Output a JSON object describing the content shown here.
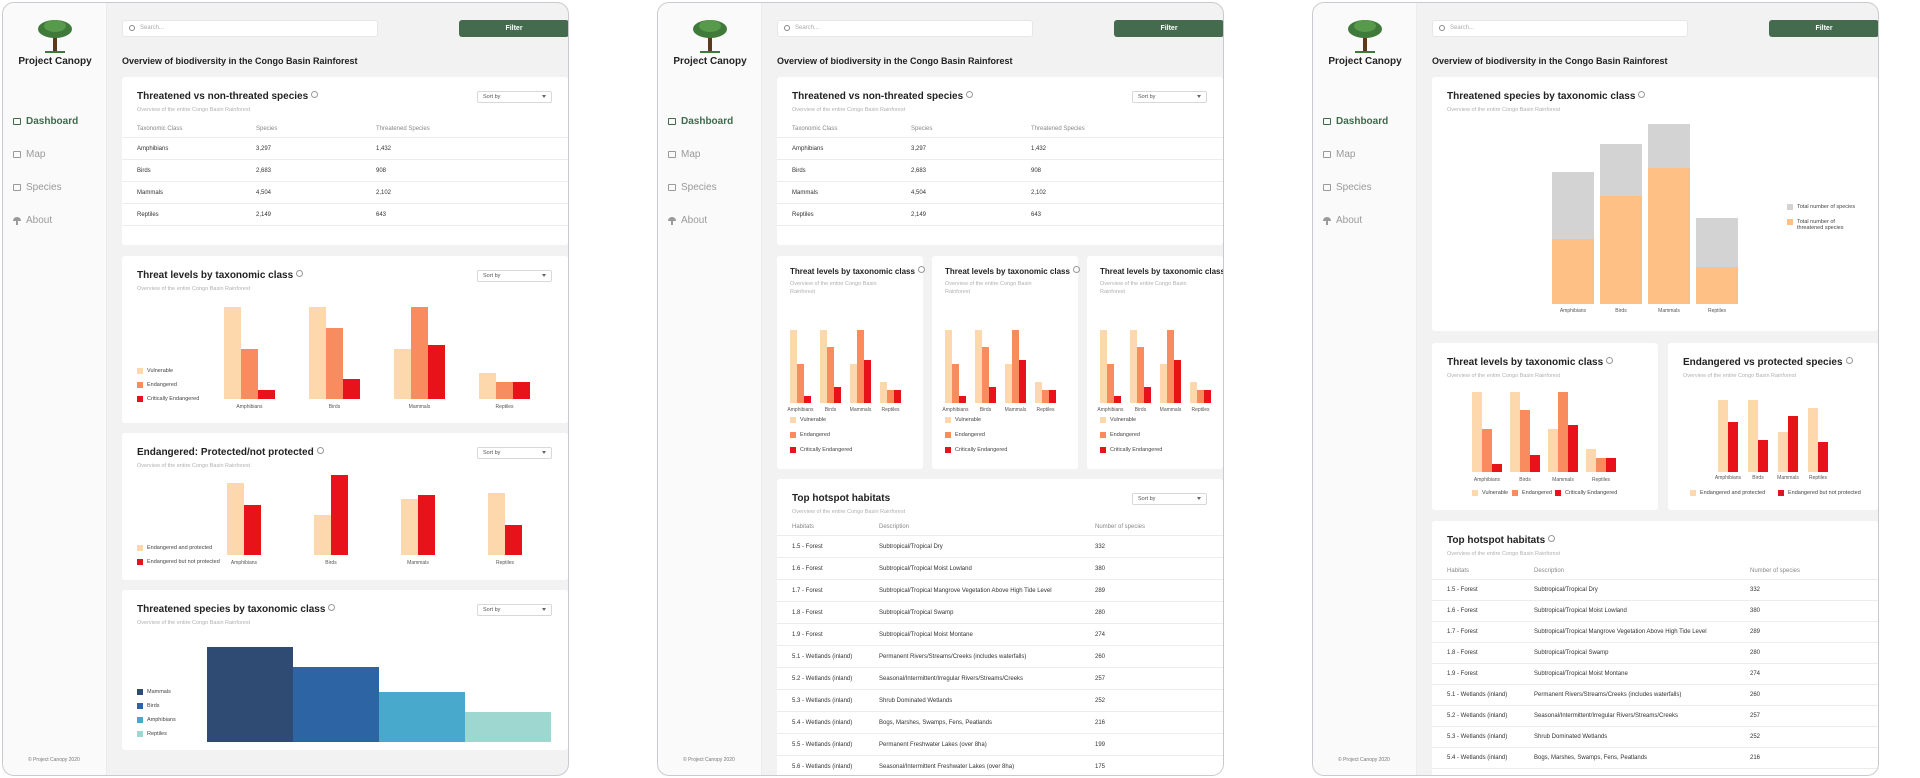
{
  "app": {
    "brand": "Project Canopy",
    "footer": "© Project Canopy 2020",
    "search_placeholder": "Search...",
    "filter_label": "Filter",
    "page_title": "Overview of biodiversity in the Congo Basin Rainforest"
  },
  "nav": [
    {
      "label": "Dashboard",
      "icon": "dashboard-icon"
    },
    {
      "label": "Map",
      "icon": "map-icon"
    },
    {
      "label": "Species",
      "icon": "species-icon"
    },
    {
      "label": "About",
      "icon": "tree-icon"
    }
  ],
  "common": {
    "sort_label": "Sort by",
    "subtitle": "Overview of the entire Congo Basin Rainforest"
  },
  "titles": {
    "threatened_vs": "Threatened vs non-threated species",
    "threat_levels": "Threat levels by taxonomic class",
    "endangered_pn": "Endangered: Protected/not protected",
    "threatened_by_class": "Threatened species by taxonomic class",
    "hotspots": "Top hotspot habitats",
    "endangered_vs_protected": "Endangered vs protected species"
  },
  "species_table": {
    "headers": [
      "Taxonomic Class",
      "Species",
      "Threatened Species"
    ],
    "rows": [
      [
        "Amphibians",
        "3,297",
        "1,432"
      ],
      [
        "Birds",
        "2,683",
        "908"
      ],
      [
        "Mammals",
        "4,504",
        "2,102"
      ],
      [
        "Reptiles",
        "2,149",
        "643"
      ]
    ]
  },
  "habitat_table": {
    "headers": [
      "Habitats",
      "Description",
      "Number of species"
    ],
    "rows": [
      [
        "1.5 - Forest",
        "Subtropical/Tropical Dry",
        "332"
      ],
      [
        "1.6 - Forest",
        "Subtropical/Tropical Moist Lowland",
        "380"
      ],
      [
        "1.7 - Forest",
        "Subtropical/Tropical Mangrove Vegetation Above High Tide Level",
        "289"
      ],
      [
        "1.8 - Forest",
        "Subtropical/Tropical Swamp",
        "280"
      ],
      [
        "1.9 - Forest",
        "Subtropical/Tropical Moist Montane",
        "274"
      ],
      [
        "5.1 - Wetlands (inland)",
        "Permanent Rivers/Streams/Creeks (includes waterfalls)",
        "260"
      ],
      [
        "5.2 - Wetlands (inland)",
        "Seasonal/Intermittent/Irregular Rivers/Streams/Creeks",
        "257"
      ],
      [
        "5.3 - Wetlands (inland)",
        "Shrub Dominated Wetlands",
        "252"
      ],
      [
        "5.4 - Wetlands (inland)",
        "Bogs, Marshes, Swamps, Fens, Peatlands",
        "216"
      ],
      [
        "5.5 - Wetlands (inland)",
        "Permanent Freshwater Lakes (over 8ha)",
        "199"
      ],
      [
        "5.6 - Wetlands (inland)",
        "Seasonal/Intermittent Freshwater Lakes (over 8ha)",
        "175"
      ]
    ]
  },
  "colors": {
    "vulnerable": "#fdd8ac",
    "endangered": "#f98c5f",
    "critical": "#e8121b",
    "gray": "#d3d3d3",
    "orange": "#fec084",
    "navy": "#2f4b74",
    "blue": "#2d64a4",
    "lightblue": "#48a9cc",
    "teal": "#9dd7cf",
    "accent": "#456b4f"
  },
  "chart_data": [
    {
      "type": "bar",
      "title": "Threat levels by taxonomic class",
      "categories": [
        "Amphibians",
        "Birds",
        "Mammals",
        "Reptiles"
      ],
      "series": [
        {
          "name": "Vulnerable",
          "values": [
            78,
            78,
            42,
            22
          ]
        },
        {
          "name": "Endangered",
          "values": [
            42,
            60,
            78,
            14
          ]
        },
        {
          "name": "Critically Endangered",
          "values": [
            8,
            17,
            46,
            14
          ]
        }
      ]
    },
    {
      "type": "bar",
      "title": "Endangered: Protected/not protected",
      "categories": [
        "Amphibians",
        "Birds",
        "Mammals",
        "Reptiles"
      ],
      "series": [
        {
          "name": "Endangered and protected",
          "values": [
            72,
            40,
            56,
            62
          ]
        },
        {
          "name": "Endangered but not protected",
          "values": [
            50,
            80,
            60,
            30
          ]
        }
      ]
    },
    {
      "type": "bar",
      "title": "Threatened species by taxonomic class",
      "categories": [
        "Mammals",
        "Birds",
        "Amphibians",
        "Reptiles"
      ],
      "series": [
        {
          "name": "Mammals",
          "values": [
            95
          ]
        },
        {
          "name": "Birds",
          "values": [
            75
          ]
        },
        {
          "name": "Amphibians",
          "values": [
            50
          ]
        },
        {
          "name": "Reptiles",
          "values": [
            30
          ]
        }
      ]
    },
    {
      "type": "bar",
      "title": "Threatened species by taxonomic class",
      "categories": [
        "Amphibians",
        "Birds",
        "Mammals",
        "Reptiles"
      ],
      "series": [
        {
          "name": "Total number of species",
          "values": [
            3297,
            4004,
            4504,
            2149
          ]
        },
        {
          "name": "Total number of threatened species",
          "values": [
            1632,
            2703,
            3404,
            930
          ]
        }
      ]
    },
    {
      "type": "bar",
      "title": "Endangered vs protected species",
      "categories": [
        "Amphibians",
        "Birds",
        "Mammals",
        "Reptiles"
      ],
      "series": [
        {
          "name": "Endangered and protected",
          "values": [
            72,
            72,
            40,
            64
          ]
        },
        {
          "name": "Endangered but not protected",
          "values": [
            50,
            32,
            56,
            30
          ]
        }
      ]
    }
  ]
}
